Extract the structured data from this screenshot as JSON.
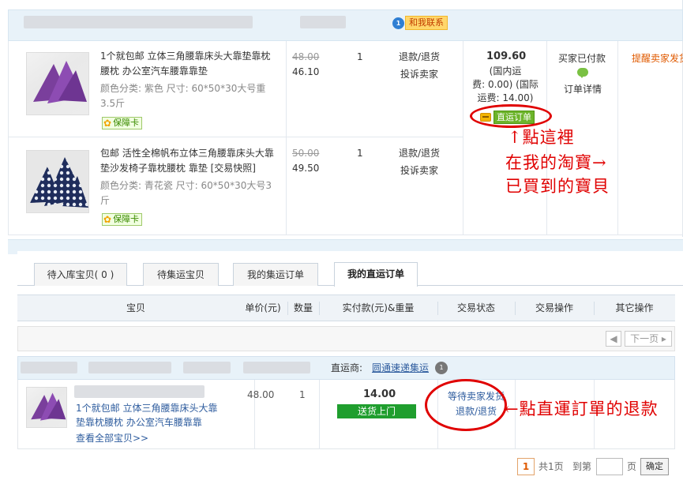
{
  "top_order": {
    "contact_badge": "和我联系",
    "items": [
      {
        "title": "1个就包邮 立体三角腰靠床头大靠垫靠枕腰枕 办公室汽车腰靠靠垫",
        "attr": "颜色分类: 紫色 尺寸: 60*50*30大号重3.5斤",
        "guarantee": "保障卡",
        "orig_price": "48.00",
        "price": "46.10",
        "qty": "1",
        "refund": "退款/退货",
        "complain": "投诉卖家"
      },
      {
        "title": "包邮 活性全棉帆布立体三角腰靠床头大靠垫沙发椅子靠枕腰枕 靠垫 [交易快照]",
        "attr": "颜色分类: 青花瓷 尺寸: 60*50*30大号3斤",
        "guarantee": "保障卡",
        "orig_price": "50.00",
        "price": "49.50",
        "qty": "1",
        "refund": "退款/退货",
        "complain": "投诉卖家"
      }
    ],
    "snapshot": "[交易快照]",
    "total": "109.60",
    "ship_line1": "(国内运",
    "ship_line2": "费: 0.00) (国际",
    "ship_line3": "运费: 14.00)",
    "direct_order": "直运订单",
    "buyer_paid": "买家已付款",
    "order_detail": "订单详情",
    "remind": "提醒卖家发货"
  },
  "annotations": {
    "top_line1": "↑點這裡",
    "top_line2": "在我的淘寶→",
    "top_line3": "已買到的寶貝",
    "bottom": "←點直運訂單的退款"
  },
  "tabs": [
    {
      "label": "待入库宝贝( 0 )"
    },
    {
      "label": "待集运宝贝"
    },
    {
      "label": "我的集运订单"
    },
    {
      "label": "我的直运订单"
    }
  ],
  "columns": {
    "item": "宝贝",
    "unit_price": "单价(元)",
    "qty": "数量",
    "paid": "实付款(元)&重量",
    "status": "交易状态",
    "action": "交易操作",
    "other": "其它操作"
  },
  "pager": {
    "next": "下一页"
  },
  "direct_order": {
    "supplier_label": "直运商:",
    "supplier_name": "圆通速递集运",
    "item_title_line1": "1个就包邮 立体三角腰靠床头大靠",
    "item_title_line2": "垫靠枕腰枕 办公室汽车腰靠靠",
    "view_all": "查看全部宝贝>>",
    "unit_price": "48.00",
    "qty": "1",
    "paid": "14.00",
    "send_btn": "送货上门",
    "status": "等待卖家发货",
    "refund": "退款/退货"
  },
  "pager_bottom": {
    "current": "1",
    "total_pages": "共1页",
    "goto": "到第",
    "page": "页",
    "ok": "确定"
  },
  "colors": {
    "annotation_red": "#e00000",
    "header_blue": "#e8f2f9",
    "link_blue": "#2e5c9e",
    "green_button": "#1f9e2e",
    "remind_orange": "#e05a00"
  }
}
